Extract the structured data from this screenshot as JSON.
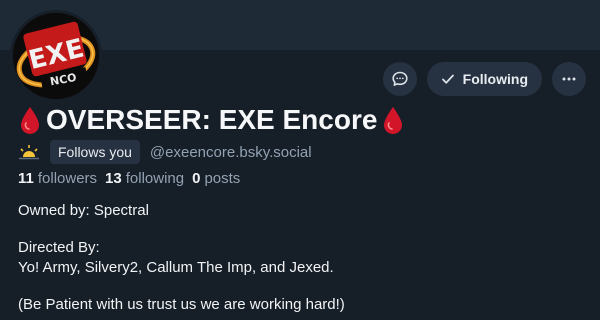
{
  "profile": {
    "display_name": "OVERSEER: EXE Encore",
    "name_emoji": "drop-of-blood",
    "follows_you_label": "Follows you",
    "handle": "@exeencore.bsky.social",
    "stats": {
      "followers_count": "11",
      "followers_label": "followers",
      "following_count": "13",
      "following_label": "following",
      "posts_count": "0",
      "posts_label": "posts"
    },
    "bio": {
      "line1": "Owned by: Spectral",
      "line2": "Directed By:",
      "line3": "Yo! Army, Silvery2, Callum The Imp, and Jexed.",
      "line4": "(Be Patient with us trust us we are working hard!)"
    }
  },
  "actions": {
    "following_label": "Following",
    "message_icon": "chat-bubble-icon",
    "more_icon": "ellipsis-icon"
  },
  "colors": {
    "background": "#161e27",
    "banner": "#1e2a36",
    "button_bg": "#263241",
    "muted_text": "#93a2b3",
    "blood_red": "#d3152a"
  }
}
